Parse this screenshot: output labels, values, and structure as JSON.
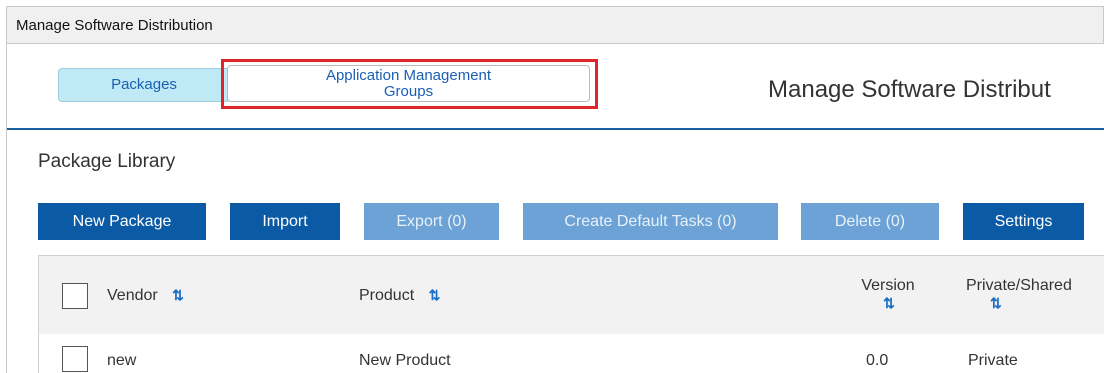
{
  "window": {
    "title": "Manage Software Distribution"
  },
  "tabs": {
    "packages": "Packages",
    "amg_line1": "Application Management",
    "amg_line2": "Groups"
  },
  "header": {
    "title": "Manage Software Distribut"
  },
  "library": {
    "title": "Package Library"
  },
  "toolbar": {
    "new_package": "New Package",
    "import": "Import",
    "export": "Export (0)",
    "create_default_tasks": "Create Default Tasks (0)",
    "delete": "Delete (0)",
    "settings": "Settings"
  },
  "table": {
    "columns": {
      "vendor": "Vendor",
      "product": "Product",
      "version": "Version",
      "private_shared": "Private/Shared"
    },
    "sort_glyph": "⇅",
    "rows": [
      {
        "vendor": "new",
        "product": "New Product",
        "version": "0.0",
        "private_shared": "Private"
      }
    ]
  },
  "colors": {
    "accent": "#0b5aa6",
    "disabled": "#6ca2d6",
    "highlight": "#e0252a",
    "tab_active": "#bfe9f5"
  }
}
